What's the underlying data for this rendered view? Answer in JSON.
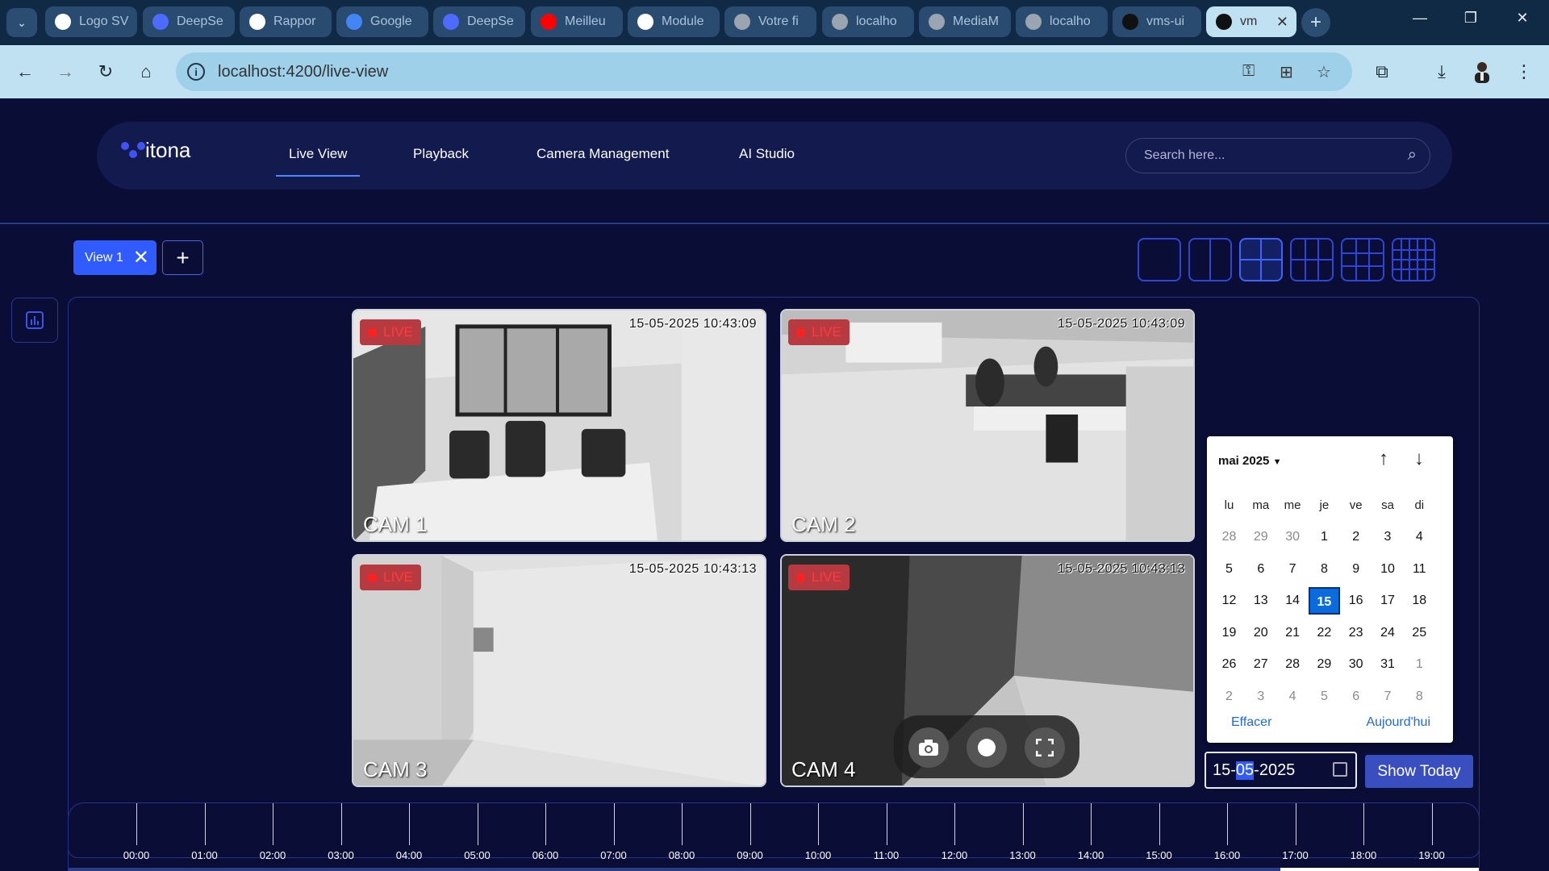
{
  "browser": {
    "tabs": [
      {
        "label": "Logo SV",
        "fav_color": "#ffffff",
        "icon": "openai-icon"
      },
      {
        "label": "DeepSe",
        "fav_color": "#4d6bfe",
        "icon": "deepseek-icon"
      },
      {
        "label": "Rappor",
        "fav_color": "#ffffff",
        "icon": "openai-icon"
      },
      {
        "label": "Google",
        "fav_color": "#4285f4",
        "icon": "google-translate-icon"
      },
      {
        "label": "DeepSe",
        "fav_color": "#4d6bfe",
        "icon": "deepseek-icon"
      },
      {
        "label": "Meilleu",
        "fav_color": "#ff0000",
        "icon": "youtube-icon"
      },
      {
        "label": "Module",
        "fav_color": "#ffffff",
        "icon": "openai-icon"
      },
      {
        "label": "Votre fi",
        "fav_color": "#9aa5b1",
        "icon": "globe-icon"
      },
      {
        "label": "localho",
        "fav_color": "#9aa5b1",
        "icon": "globe-icon"
      },
      {
        "label": "MediaM",
        "fav_color": "#9aa5b1",
        "icon": "globe-icon"
      },
      {
        "label": "localho",
        "fav_color": "#9aa5b1",
        "icon": "globe-icon"
      },
      {
        "label": "vms-ui",
        "fav_color": "#111111",
        "icon": "angular-icon"
      },
      {
        "label": "vm",
        "fav_color": "#111111",
        "icon": "angular-icon"
      }
    ],
    "url": "localhost:4200/live-view"
  },
  "nav": {
    "brand": "itona",
    "links": [
      "Live View",
      "Playback",
      "Camera Management",
      "AI Studio"
    ],
    "search_placeholder": "Search here..."
  },
  "views": {
    "tab_label": "View 1",
    "close_glyph": "✕",
    "add_glyph": "+"
  },
  "cameras": [
    {
      "name": "CAM 1",
      "live": "LIVE",
      "timestamp": "15-05-2025 10:43:09"
    },
    {
      "name": "CAM 2",
      "live": "LIVE",
      "timestamp": "15-05-2025 10:43:09"
    },
    {
      "name": "CAM 3",
      "live": "LIVE",
      "timestamp": "15-05-2025 10:43:13"
    },
    {
      "name": "CAM 4",
      "live": "LIVE",
      "timestamp": "15-05-2025 10:43:13"
    }
  ],
  "calendar": {
    "month_label": "mai 2025",
    "weekdays": [
      "lu",
      "ma",
      "me",
      "je",
      "ve",
      "sa",
      "di"
    ],
    "weeks": [
      [
        [
          "28",
          1
        ],
        [
          "29",
          1
        ],
        [
          "30",
          1
        ],
        [
          "1",
          0
        ],
        [
          "2",
          0
        ],
        [
          "3",
          0
        ],
        [
          "4",
          0
        ]
      ],
      [
        [
          "5",
          0
        ],
        [
          "6",
          0
        ],
        [
          "7",
          0
        ],
        [
          "8",
          0
        ],
        [
          "9",
          0
        ],
        [
          "10",
          0
        ],
        [
          "11",
          0
        ]
      ],
      [
        [
          "12",
          0
        ],
        [
          "13",
          0
        ],
        [
          "14",
          0
        ],
        [
          "15",
          2
        ],
        [
          "16",
          0
        ],
        [
          "17",
          0
        ],
        [
          "18",
          0
        ]
      ],
      [
        [
          "19",
          0
        ],
        [
          "20",
          0
        ],
        [
          "21",
          0
        ],
        [
          "22",
          0
        ],
        [
          "23",
          0
        ],
        [
          "24",
          0
        ],
        [
          "25",
          0
        ]
      ],
      [
        [
          "26",
          0
        ],
        [
          "27",
          0
        ],
        [
          "28",
          0
        ],
        [
          "29",
          0
        ],
        [
          "30",
          0
        ],
        [
          "31",
          0
        ],
        [
          "1",
          1
        ]
      ],
      [
        [
          "2",
          1
        ],
        [
          "3",
          1
        ],
        [
          "4",
          1
        ],
        [
          "5",
          1
        ],
        [
          "6",
          1
        ],
        [
          "7",
          1
        ],
        [
          "8",
          1
        ]
      ]
    ],
    "clear_label": "Effacer",
    "today_label": "Aujourd'hui"
  },
  "date_input": {
    "day": "15-",
    "month": "05",
    "year": "-2025"
  },
  "show_today_label": "Show Today",
  "timeline": {
    "hours": [
      "00:00",
      "01:00",
      "02:00",
      "03:00",
      "04:00",
      "05:00",
      "06:00",
      "07:00",
      "08:00",
      "09:00",
      "10:00",
      "11:00",
      "12:00",
      "13:00",
      "14:00",
      "15:00",
      "16:00",
      "17:00",
      "18:00",
      "19:00"
    ]
  }
}
